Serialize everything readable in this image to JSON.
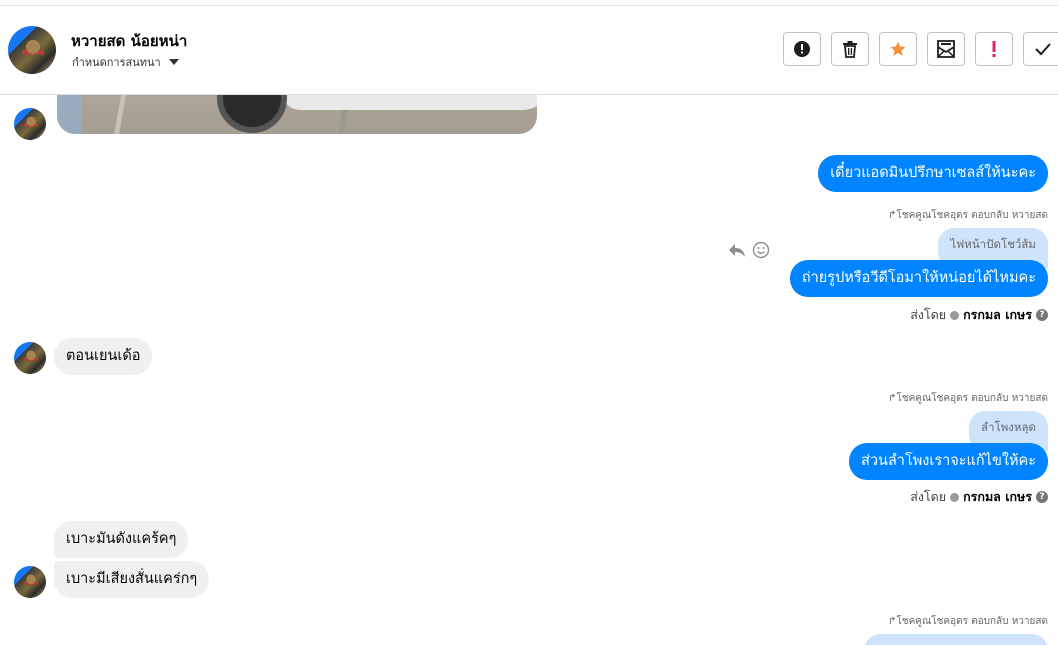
{
  "header": {
    "contact_name": "หวายสด น้อยหน่า",
    "settings_label": "กำหนดการสนทนา",
    "toolbar": {
      "icons": [
        "alert-circle-icon",
        "trash-icon",
        "star-icon",
        "mark-unread-icon",
        "exclamation-icon",
        "check-icon"
      ],
      "star_color": "#f7923b",
      "exclamation_color": "#e0245e"
    }
  },
  "messages": {
    "out1": "เดี๋ยวแอดมินปรึกษาเซลส์ให้นะคะ",
    "reply1": {
      "note": "โชคคูณโชคอุดร ตอบกลับ หวายสด",
      "quoted": "ไฟหน้าปัดโชว์ส้ม",
      "text": "ถ่ายรูปหรือวีดีโอมาให้หน่อยได้ไหมคะ",
      "sent_by_label": "ส่งโดย",
      "sent_by_name": "กรกมล เกษร"
    },
    "in1": "ตอนเยนเด้อ",
    "reply2": {
      "note": "โชคคูณโชคอุดร ตอบกลับ หวายสด",
      "quoted": "ลำโพงหลุด",
      "text": "ส่วนลำโพงเราจะแก้ไขให้คะ",
      "sent_by_label": "ส่งโดย",
      "sent_by_name": "กรกมล เกษร"
    },
    "in2": "เบาะมันดังแคร้คๆ",
    "in3": "เบาะมีเสียงสั่นแคร่กๆ",
    "reply3": {
      "note": "โชคคูณโชคอุดร ตอบกลับ หวายสด"
    }
  },
  "colors": {
    "outgoing_bubble": "#0084ff",
    "incoming_bubble": "#f0f0f0",
    "quoted_bubble": "#cfe3fb"
  }
}
